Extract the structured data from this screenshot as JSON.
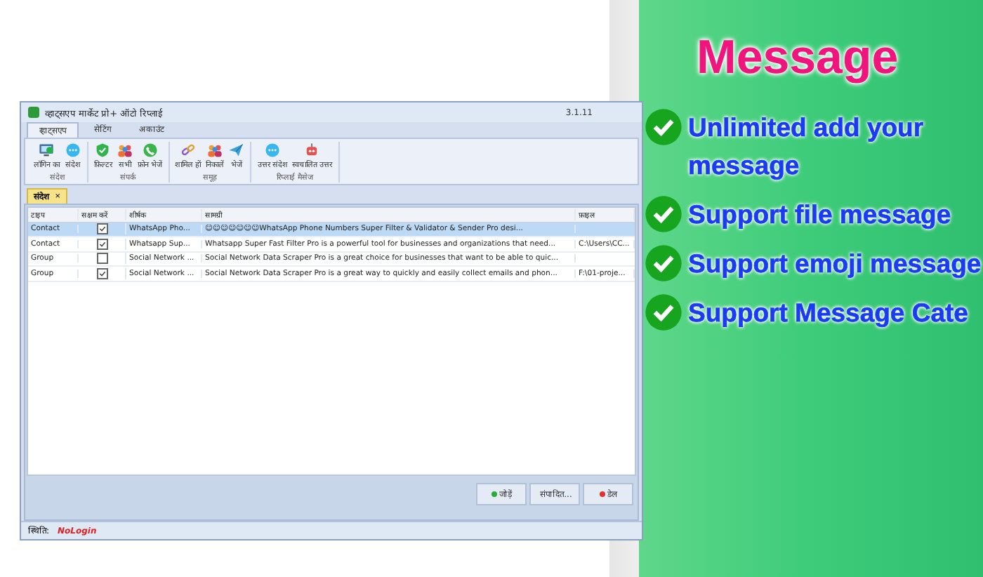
{
  "window": {
    "title": "व्हाट्सएप मार्केट प्रो+ ऑटो रिप्लाई",
    "version": "3.1.11"
  },
  "menu_tabs": [
    {
      "label": "व्हाट्सएप",
      "selected": true
    },
    {
      "label": "सेटिंग",
      "selected": false
    },
    {
      "label": "अकाउंट",
      "selected": false
    }
  ],
  "ribbon_groups": [
    {
      "label": "संदेश",
      "buttons": [
        {
          "label": "लॉगिन का"
        },
        {
          "label": "संदेश"
        }
      ]
    },
    {
      "label": "संपर्क",
      "buttons": [
        {
          "label": "फ़िल्टर"
        },
        {
          "label": "सभी"
        },
        {
          "label": "फ़ोन भेजें"
        }
      ]
    },
    {
      "label": "समूह",
      "buttons": [
        {
          "label": "शामिल हों"
        },
        {
          "label": "निकालें"
        },
        {
          "label": "भेजें"
        }
      ]
    },
    {
      "label": "रिप्लाई मैसेज",
      "buttons": [
        {
          "label": "उत्तर संदेश"
        },
        {
          "label": "स्वचालित उत्तर"
        }
      ]
    }
  ],
  "doc_tab": {
    "label": "संदेश",
    "close": "×"
  },
  "table": {
    "columns": [
      "टाइप",
      "सक्षम करें",
      "शीर्षक",
      "सामग्री",
      "फ़ाइल"
    ],
    "rows": [
      {
        "type": "Contact",
        "enabled": true,
        "title": "WhatsApp Pho...",
        "content": "☺☺☺☺☺☺☺WhatsApp Phone Numbers Super Filter & Validator & Sender Pro desi...",
        "file": "",
        "selected": true
      },
      {
        "type": "Contact",
        "enabled": true,
        "title": "Whatsapp Sup...",
        "content": "Whatsapp Super Fast Filter Pro is a powerful tool for businesses and organizations that need...",
        "file": "C:\\Users\\CC...",
        "selected": false
      },
      {
        "type": "Group",
        "enabled": false,
        "title": "Social Network ...",
        "content": "Social Network Data Scraper Pro is a great choice for businesses that want to be able to quic...",
        "file": "",
        "selected": false
      },
      {
        "type": "Group",
        "enabled": true,
        "title": "Social Network ...",
        "content": "Social Network Data Scraper Pro is a great way to quickly and easily collect emails and phon...",
        "file": "F:\\01-proje...",
        "selected": false
      }
    ]
  },
  "actions": [
    {
      "label": "जोड़ें",
      "kind": "add"
    },
    {
      "label": "संपादित...",
      "kind": "edit"
    },
    {
      "label": "डेल",
      "kind": "delete"
    }
  ],
  "status_bar": {
    "label": "स्थिति:",
    "value": "NoLogin"
  },
  "promo": {
    "heading": "Message",
    "features": [
      "Unlimited add your message",
      "Support file message",
      "Support emoji message",
      "Support Message Cate"
    ]
  }
}
